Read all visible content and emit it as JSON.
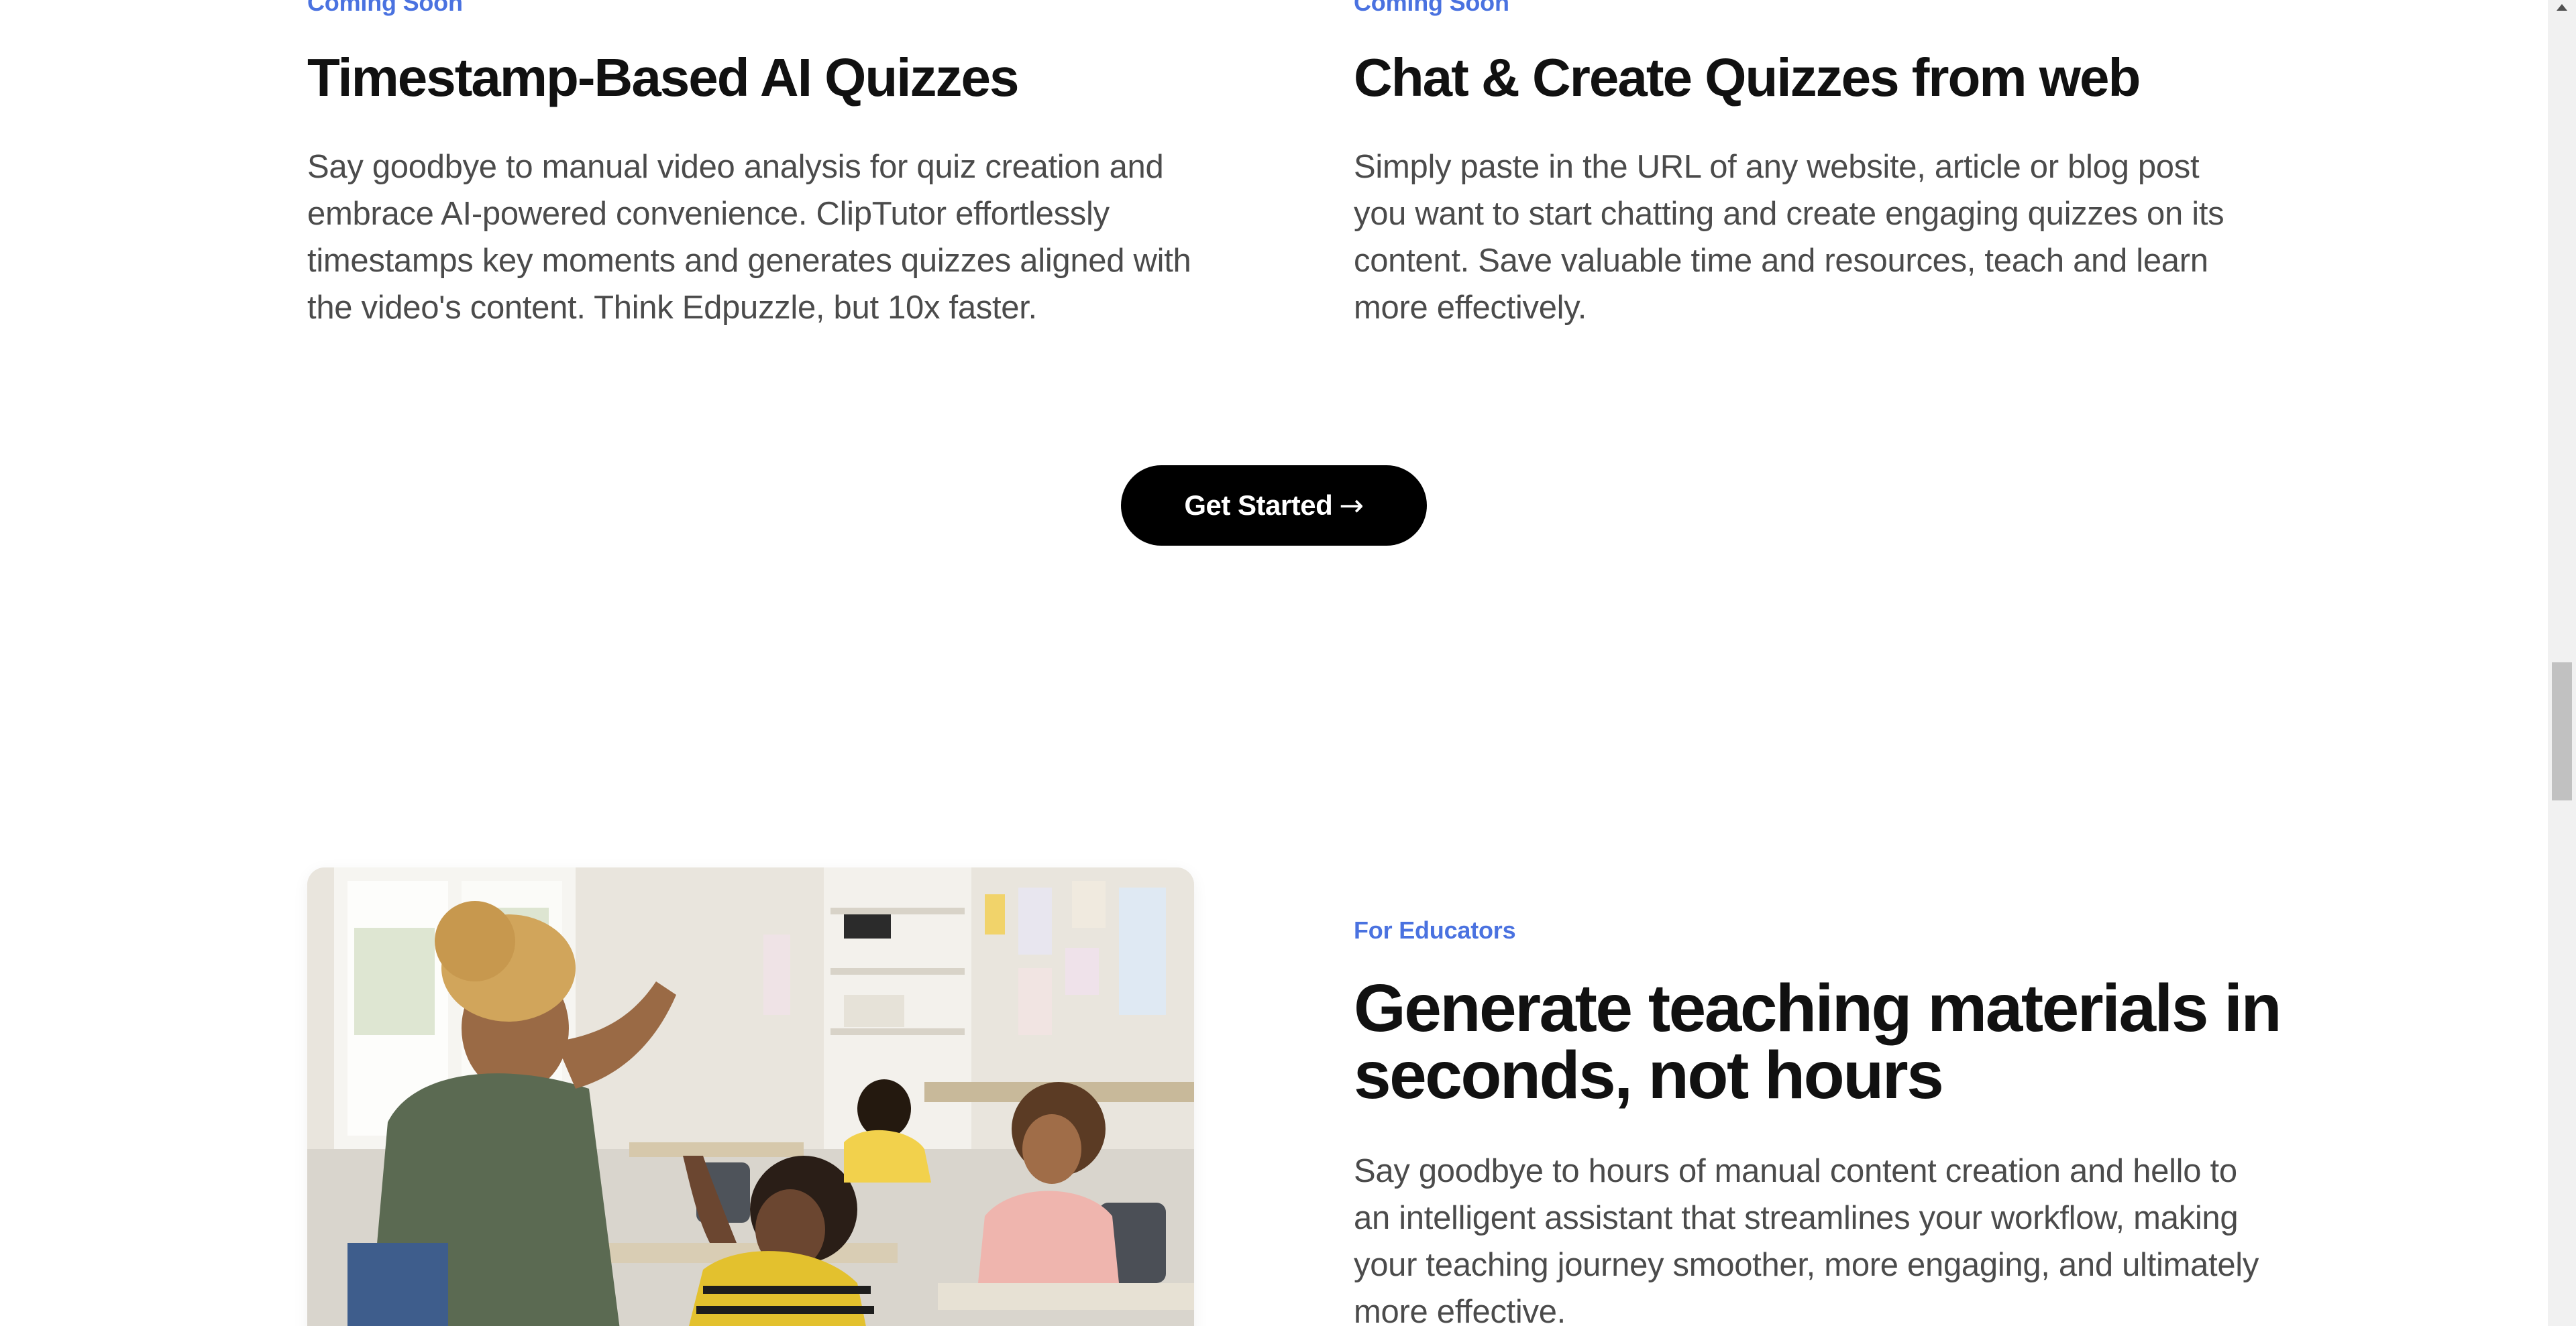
{
  "features_top": {
    "left": {
      "eyebrow": "Coming Soon",
      "title": "Timestamp-Based AI Quizzes",
      "body": "Say goodbye to manual video analysis for quiz creation and embrace AI-powered convenience. ClipTutor effortlessly timestamps key moments and generates quizzes aligned with the video's content. Think Edpuzzle, but 10x faster."
    },
    "right": {
      "eyebrow": "Coming Soon",
      "title": "Chat & Create Quizzes from web",
      "body": "Simply paste in the URL of any website, article or blog post you want to start chatting and create engaging quizzes on its content. Save valuable time and resources, teach and learn more effectively."
    }
  },
  "cta": {
    "label": "Get Started",
    "arrow": "→"
  },
  "educators": {
    "eyebrow": "For Educators",
    "title": "Generate teaching materials in seconds, not hours",
    "body": "Say goodbye to hours of manual content creation and hello to an intelligent assistant that streamlines your workflow, making your teaching journey smoother, more engaging, and ultimately more effective."
  },
  "colors": {
    "accent": "#4a72e0",
    "cta_bg": "#000000",
    "heading": "#111111",
    "body_text": "#4b4b4b"
  }
}
